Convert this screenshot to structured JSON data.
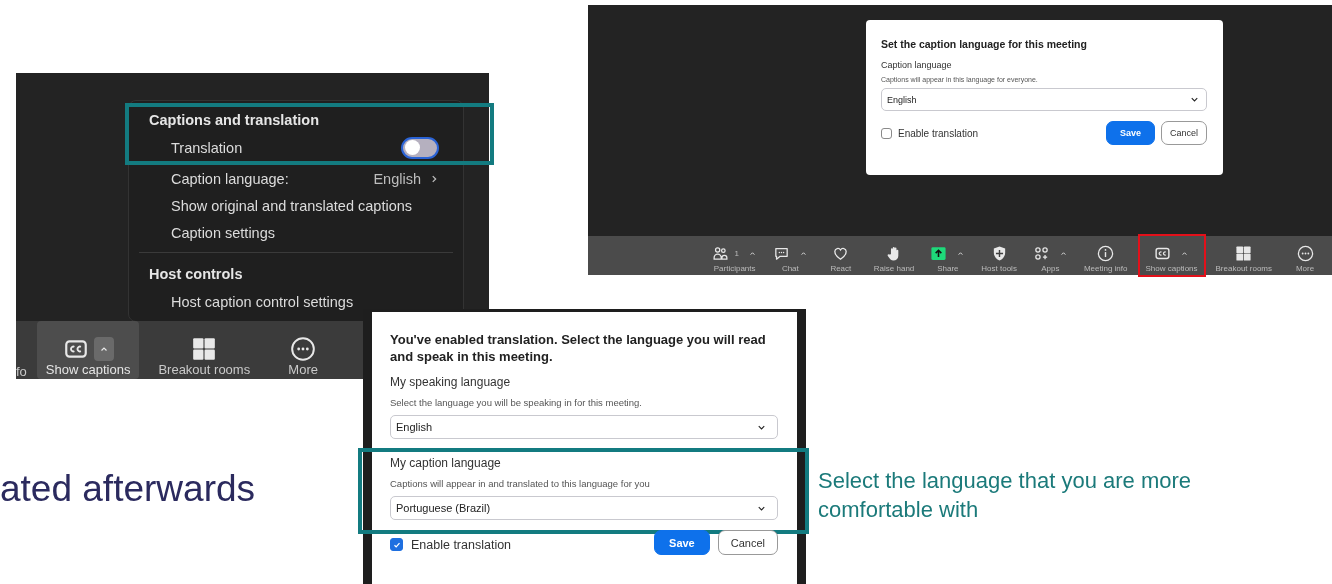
{
  "slide_heading_fragment": "ated afterwards",
  "side_note": "Select the language that you are more comfortable with",
  "menu_screenshot": {
    "menu": {
      "sections": [
        {
          "title": "Captions and translation",
          "framed": true,
          "items": [
            {
              "kind": "toggle",
              "label": "Translation",
              "on": false,
              "framed": true
            },
            {
              "kind": "submenu",
              "label": "Caption language:",
              "value": "English",
              "framed": false
            },
            {
              "kind": "plain",
              "label": "Show original and translated captions",
              "framed": false
            },
            {
              "kind": "plain",
              "label": "Caption settings",
              "framed": false
            }
          ]
        },
        {
          "title": "Host controls",
          "framed": false,
          "items": [
            {
              "kind": "plain",
              "label": "Host caption control settings",
              "framed": false
            }
          ]
        }
      ]
    },
    "toolbar": [
      {
        "kind": "text",
        "label": "fo",
        "caret": false,
        "highlighted": false
      },
      {
        "kind": "captions",
        "label": "Show captions",
        "caret": true,
        "highlighted": true
      },
      {
        "kind": "breakout",
        "label": "Breakout rooms",
        "caret": false,
        "highlighted": false
      },
      {
        "kind": "more",
        "label": "More",
        "caret": false,
        "highlighted": false
      }
    ]
  },
  "meeting_screenshot": {
    "dialog": {
      "title": "Set the caption language for this meeting",
      "fields": [
        {
          "label": "Caption language",
          "hint": "Captions will appear in this language for everyone.",
          "value": "English",
          "framed": false
        }
      ],
      "checkbox": {
        "label": "Enable translation",
        "checked": false
      },
      "buttons": [
        {
          "kind": "primary",
          "label": "Save"
        },
        {
          "kind": "secondary",
          "label": "Cancel"
        }
      ]
    },
    "toolbar": [
      {
        "kind": "participants",
        "label": "Participants",
        "count": "1",
        "caret": true,
        "highlighted": false
      },
      {
        "kind": "chat",
        "label": "Chat",
        "caret": true,
        "highlighted": false
      },
      {
        "kind": "react",
        "label": "React",
        "caret": false,
        "highlighted": false
      },
      {
        "kind": "hand",
        "label": "Raise hand",
        "caret": false,
        "highlighted": false
      },
      {
        "kind": "share",
        "label": "Share",
        "caret": true,
        "highlighted": false
      },
      {
        "kind": "shield",
        "label": "Host tools",
        "caret": false,
        "highlighted": false
      },
      {
        "kind": "apps",
        "label": "Apps",
        "caret": true,
        "highlighted": false
      },
      {
        "kind": "info",
        "label": "Meeting info",
        "caret": false,
        "highlighted": false
      },
      {
        "kind": "captions",
        "label": "Show captions",
        "caret": true,
        "highlighted": true
      },
      {
        "kind": "breakout",
        "label": "Breakout rooms",
        "caret": false,
        "highlighted": false
      },
      {
        "kind": "more",
        "label": "More",
        "caret": false,
        "highlighted": false
      }
    ]
  },
  "translation_dialog": {
    "title": "You've enabled translation. Select the language you will read and speak in this meeting.",
    "fields": [
      {
        "label": "My speaking language",
        "hint": "Select the language you will be speaking in for this meeting.",
        "value": "English",
        "framed": false
      },
      {
        "label": "My caption language",
        "hint": "Captions will appear in and translated to this language for you",
        "value": "Portuguese (Brazil)",
        "framed": true
      }
    ],
    "checkbox": {
      "label": "Enable translation",
      "checked": true
    },
    "buttons": [
      {
        "kind": "primary",
        "label": "Save"
      },
      {
        "kind": "secondary",
        "label": "Cancel"
      }
    ]
  }
}
